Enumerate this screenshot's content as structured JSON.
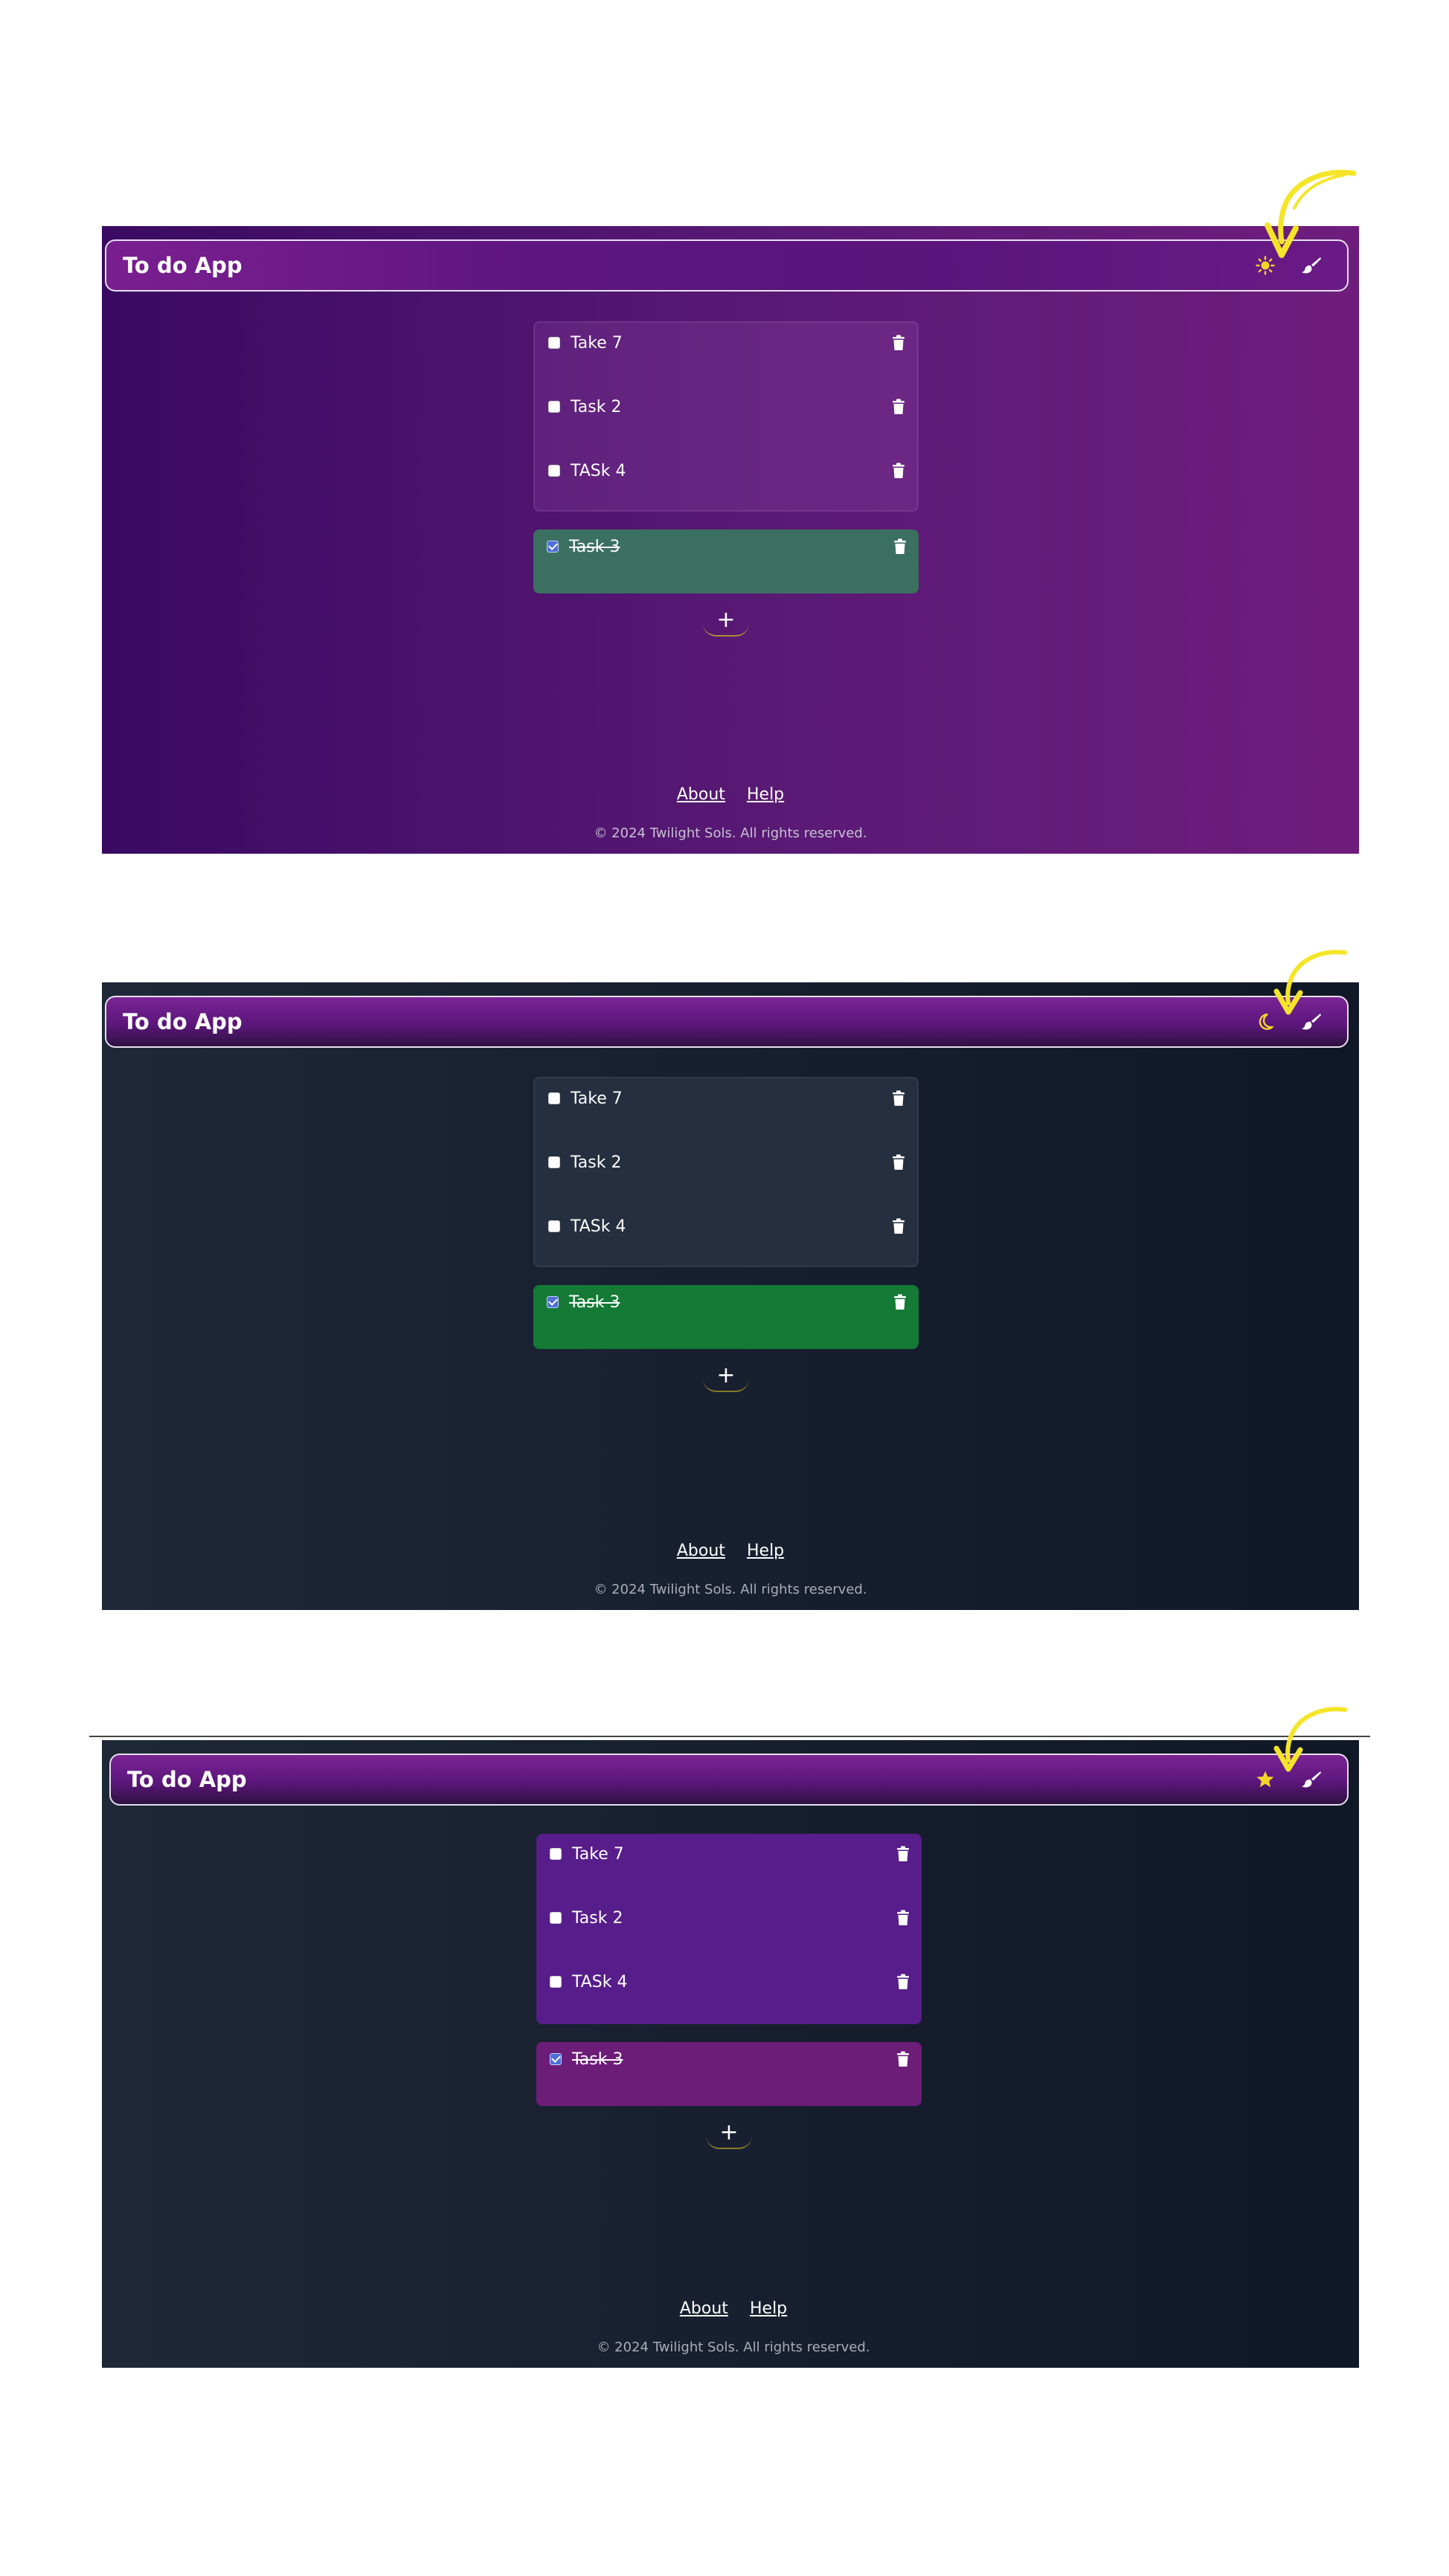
{
  "app": {
    "title": "To do App",
    "theme_toggle_label": "Toggle theme",
    "customize_label": "Customize"
  },
  "tasks": [
    {
      "label": "Take 7",
      "checked": false
    },
    {
      "label": "Task 2",
      "checked": false
    },
    {
      "label": "TASk 4",
      "checked": false
    }
  ],
  "completed_tasks": [
    {
      "label": "Task 3",
      "checked": true
    }
  ],
  "add_button_label": "+",
  "footer": {
    "links": [
      "About",
      "Help"
    ],
    "copyright": "© 2024 Twilight Sols. All rights reserved."
  },
  "variants": [
    {
      "theme": "purple",
      "theme_icon": "sun-icon",
      "done_color": "#3b7060"
    },
    {
      "theme": "dark",
      "theme_icon": "moon-icon",
      "done_color": "#147a36"
    },
    {
      "theme": "dark-purple",
      "theme_icon": "star-icon",
      "done_color": "#6c1d78"
    }
  ],
  "colors": {
    "annotation_arrow": "#f5e52a",
    "icon_highlight": "#f5d52a"
  }
}
